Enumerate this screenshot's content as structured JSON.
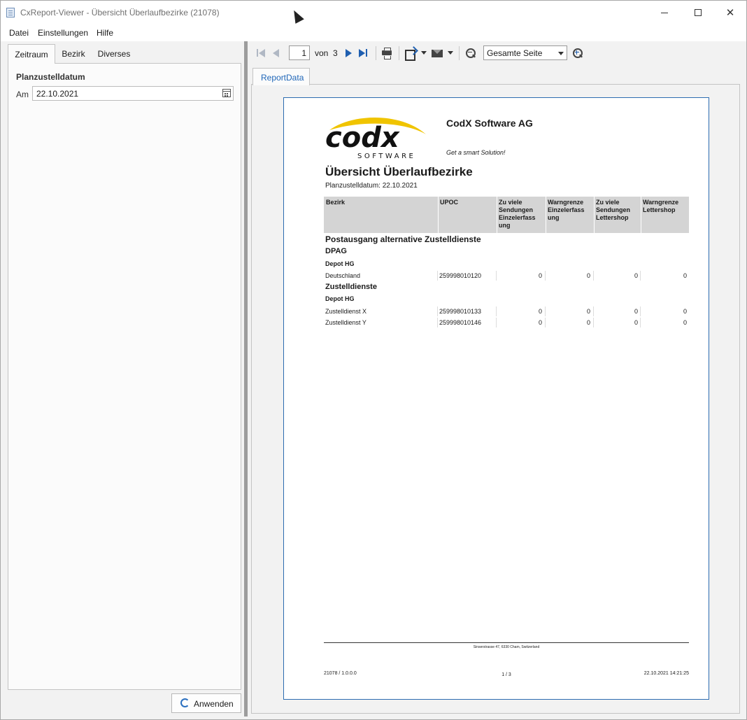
{
  "window": {
    "title": "CxReport-Viewer - Übersicht Überlaufbezirke (21078)"
  },
  "menu": {
    "items": [
      {
        "label": "Datei"
      },
      {
        "label": "Einstellungen"
      },
      {
        "label": "Hilfe"
      }
    ]
  },
  "left_panel": {
    "tabs": [
      "Zeitraum",
      "Bezirk",
      "Diverses"
    ],
    "section_label": "Planzustelldatum",
    "date_label": "Am",
    "date_value": "22.10.2021",
    "apply_label": "Anwenden"
  },
  "toolbar": {
    "page_current": "1",
    "page_of_label": "von",
    "page_total": "3",
    "zoom_mode": "Gesamte Seite"
  },
  "viewer": {
    "tab_label": "ReportData"
  },
  "report": {
    "company": "CodX Software AG",
    "slogan": "Get a smart Solution!",
    "logo_text": "codx",
    "logo_sub": "SOFTWARE",
    "title": "Übersicht Überlaufbezirke",
    "subtitle": "Planzustelldatum: 22.10.2021",
    "columns": [
      "Bezirk",
      "UPOC",
      "Zu viele\nSendungen\nEinzelerfass\nung",
      "Warngrenze\nEinzelerfass\nung",
      "Zu viele\nSendungen\nLettershop",
      "Warngrenze\nLettershop"
    ],
    "group_title": "Postausgang alternative Zustelldienste",
    "groups": [
      {
        "name": "DPAG",
        "depot": "Depot HG",
        "rows": [
          {
            "bezirk": "Deutschland",
            "upoc": "259998010120",
            "v1": "0",
            "v2": "0",
            "v3": "0",
            "v4": "0"
          }
        ]
      },
      {
        "name": "Zustelldienste",
        "depot": "Depot HG",
        "rows": [
          {
            "bezirk": "Zustelldienst X",
            "upoc": "259998010133",
            "v1": "0",
            "v2": "0",
            "v3": "0",
            "v4": "0"
          },
          {
            "bezirk": "Zustelldienst Y",
            "upoc": "259998010146",
            "v1": "0",
            "v2": "0",
            "v3": "0",
            "v4": "0"
          }
        ]
      }
    ],
    "footer_address": "Sinserstrasse 47, 6330 Cham, Switzerland",
    "footer_version": "21078 / 1.0.0.0",
    "footer_page": "1 / 3",
    "footer_datetime": "22.10.2021 14:21:25"
  },
  "colors": {
    "accent": "#1f66b8",
    "logo_yellow": "#f0c400",
    "header_gray": "#d4d4d4"
  }
}
